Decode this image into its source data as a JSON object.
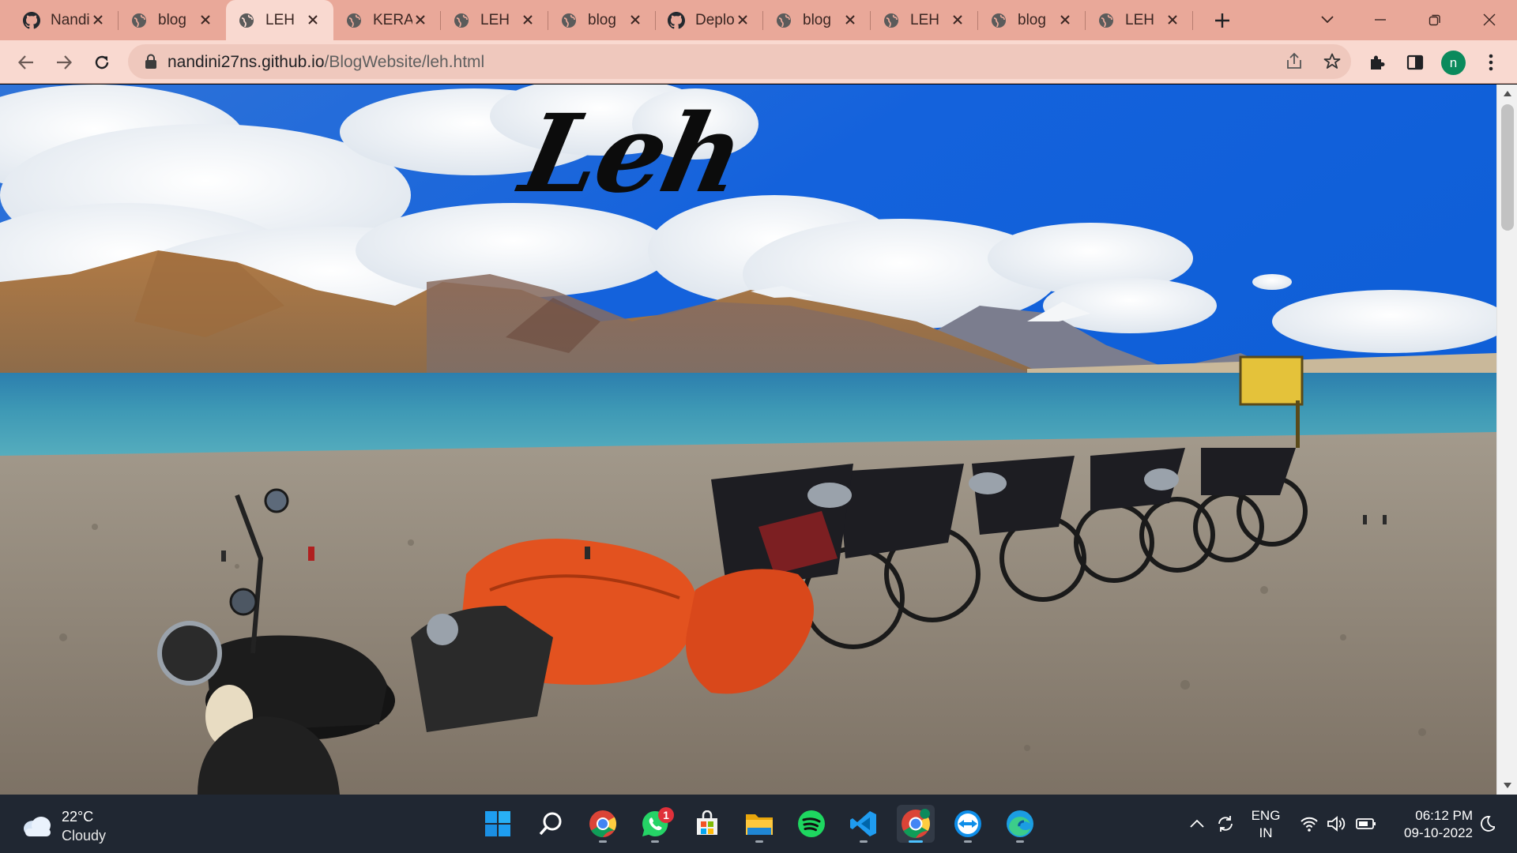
{
  "browser": {
    "tabs": [
      {
        "title": "Nandini",
        "favicon": "github-icon",
        "active": false
      },
      {
        "title": "blog",
        "favicon": "globe-icon",
        "active": false
      },
      {
        "title": "LEH",
        "favicon": "globe-icon",
        "active": true
      },
      {
        "title": "KERALA",
        "favicon": "globe-icon",
        "active": false
      },
      {
        "title": "LEH",
        "favicon": "globe-icon",
        "active": false
      },
      {
        "title": "blog",
        "favicon": "globe-icon",
        "active": false
      },
      {
        "title": "Deploy",
        "favicon": "github-icon",
        "active": false
      },
      {
        "title": "blog",
        "favicon": "globe-icon",
        "active": false
      },
      {
        "title": "LEH",
        "favicon": "globe-icon",
        "active": false
      },
      {
        "title": "blog",
        "favicon": "globe-icon",
        "active": false
      },
      {
        "title": "LEH",
        "favicon": "globe-icon",
        "active": false
      }
    ],
    "address": {
      "host": "nandini27ns.github.io",
      "path": "/BlogWebsite/leh.html"
    },
    "profile_initial": "n",
    "theme_colors": {
      "tabstrip": "#e9a899",
      "toolbar": "#f9d9d0",
      "omnibox": "#efc8bd"
    }
  },
  "page": {
    "title": "Leh"
  },
  "taskbar": {
    "weather": {
      "temp": "22°C",
      "condition": "Cloudy"
    },
    "apps": [
      {
        "name": "start",
        "icon": "windows-icon"
      },
      {
        "name": "search",
        "icon": "search-icon"
      },
      {
        "name": "chrome",
        "icon": "chrome-icon"
      },
      {
        "name": "whatsapp",
        "icon": "whatsapp-icon",
        "badge": "1"
      },
      {
        "name": "store",
        "icon": "store-icon"
      },
      {
        "name": "file-explorer",
        "icon": "folder-icon"
      },
      {
        "name": "spotify",
        "icon": "spotify-icon"
      },
      {
        "name": "vscode",
        "icon": "vscode-icon"
      },
      {
        "name": "chrome-profile",
        "icon": "chrome-icon",
        "active": true
      },
      {
        "name": "teamviewer",
        "icon": "teamviewer-icon"
      },
      {
        "name": "edge",
        "icon": "edge-icon"
      }
    ],
    "tray": {
      "lang_top": "ENG",
      "lang_bottom": "IN",
      "time": "06:12 PM",
      "date": "09-10-2022"
    }
  }
}
